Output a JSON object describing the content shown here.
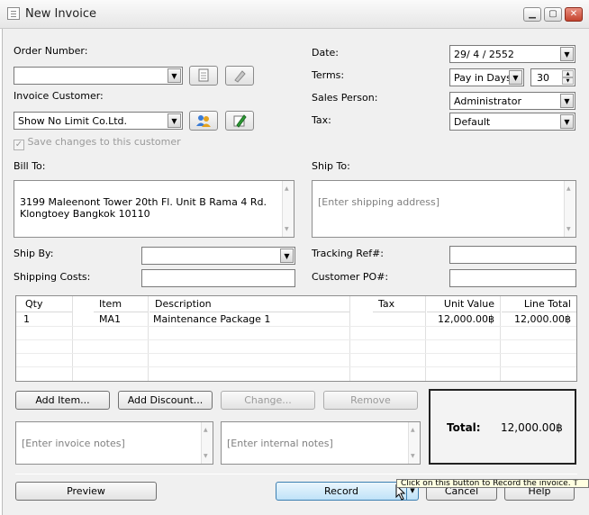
{
  "window": {
    "title": "New Invoice",
    "min": "▁",
    "max": "▢",
    "close": "✕"
  },
  "order": {
    "label": "Order Number:",
    "value": ""
  },
  "customer": {
    "label": "Invoice Customer:",
    "value": "Show No Limit Co.Ltd.",
    "save_changes": "Save changes to this customer"
  },
  "date": {
    "label": "Date:",
    "value": "29/ 4 /  2552"
  },
  "terms": {
    "label": "Terms:",
    "value": "Pay in Days",
    "days": "30"
  },
  "sales_person": {
    "label": "Sales Person:",
    "value": "Administrator"
  },
  "tax": {
    "label": "Tax:",
    "value": "Default"
  },
  "bill_to": {
    "label": "Bill To:",
    "value": "3199 Maleenont Tower 20th Fl. Unit B Rama 4 Rd.\nKlongtoey Bangkok 10110"
  },
  "ship_to": {
    "label": "Ship To:",
    "placeholder": "[Enter shipping address]"
  },
  "ship_by": {
    "label": "Ship By:",
    "value": ""
  },
  "shipping_costs": {
    "label": "Shipping Costs:",
    "value": ""
  },
  "tracking": {
    "label": "Tracking Ref#:",
    "value": ""
  },
  "customer_po": {
    "label": "Customer PO#:",
    "value": ""
  },
  "items": {
    "headers": {
      "qty": "Qty",
      "item": "Item",
      "description": "Description",
      "tax": "Tax",
      "unit_value": "Unit Value",
      "line_total": "Line Total"
    },
    "rows": [
      {
        "qty": "1",
        "item": "MA1",
        "description": "Maintenance Package 1",
        "tax": "",
        "unit_value": "12,000.00฿",
        "line_total": "12,000.00฿"
      }
    ]
  },
  "actions": {
    "add_item": "Add Item...",
    "add_discount": "Add Discount...",
    "change": "Change...",
    "remove": "Remove"
  },
  "notes": {
    "invoice_placeholder": "[Enter invoice notes]",
    "internal_placeholder": "[Enter internal notes]"
  },
  "total": {
    "label": "Total:",
    "value": "12,000.00฿"
  },
  "footer": {
    "preview": "Preview",
    "record": "Record",
    "cancel": "Cancel",
    "help": "Help"
  },
  "tooltip": "Click on this button to Record the invoice. T"
}
